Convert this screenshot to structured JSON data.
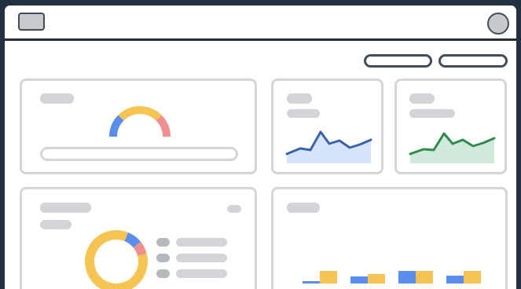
{
  "window": {
    "menu_icon": "window-icon",
    "avatar_icon": "user-avatar-icon"
  },
  "toolbar": {
    "buttons": [
      "button-1",
      "button-2"
    ]
  },
  "colors": {
    "frame": "#222d3a",
    "placeholder": "#d2d4d7",
    "card_border": "#d4d6d9",
    "blue": "#5b8def",
    "blue_line": "#3b63ad",
    "blue_fill": "#d6e3f8",
    "green_line": "#2f8a4c",
    "green_fill": "#cfeadb",
    "yellow": "#f6c452",
    "red": "#ef8f8f"
  },
  "gauge": {
    "value_fraction": 0.5
  },
  "donut": {
    "segments": [
      0.85,
      0.08,
      0.07
    ]
  },
  "bar_chart": {
    "groups": [
      {
        "blue": 0.15,
        "yellow": 0.9
      },
      {
        "blue": 0.55,
        "yellow": 0.7
      },
      {
        "blue": 0.95,
        "yellow": 0.95
      },
      {
        "blue": 0.6,
        "yellow": 0.95
      }
    ]
  }
}
